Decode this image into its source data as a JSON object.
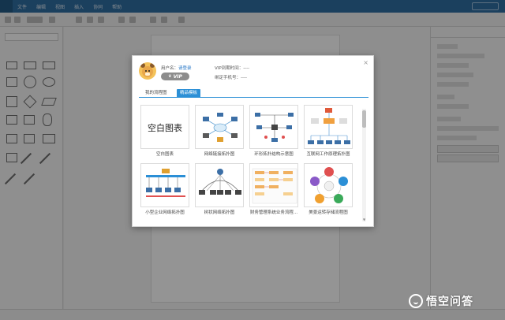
{
  "menubar": {
    "items": [
      "文件",
      "编辑",
      "视图",
      "插入",
      "协同",
      "帮助"
    ]
  },
  "modal": {
    "user_label": "用户名：",
    "user_link": "请登录",
    "vip_badge": "VIP",
    "vip_expiry": "VIP到期时间：----",
    "bind_phone": "绑定手机号：----",
    "tabs": [
      {
        "label": "我的流程图",
        "active": false
      },
      {
        "label": "精品模板",
        "active": true
      }
    ],
    "templates": [
      {
        "label": "空白图表",
        "thumb_text": "空白图表"
      },
      {
        "label": "网络链接拓扑图"
      },
      {
        "label": "环形拓扑结构示意图"
      },
      {
        "label": "互联网工作原理拓扑图"
      },
      {
        "label": "小型企业网络拓扑图"
      },
      {
        "label": "树状网络拓扑图"
      },
      {
        "label": "财务管理系统业务流程..."
      },
      {
        "label": "美景运转存储流程图"
      }
    ]
  },
  "watermark": {
    "text": "悟空问答"
  },
  "colors": {
    "accent": "#2b8fd6",
    "menubar": "#2f6fa3",
    "link": "#2b7ac8",
    "vip": "#8c8c8c"
  }
}
